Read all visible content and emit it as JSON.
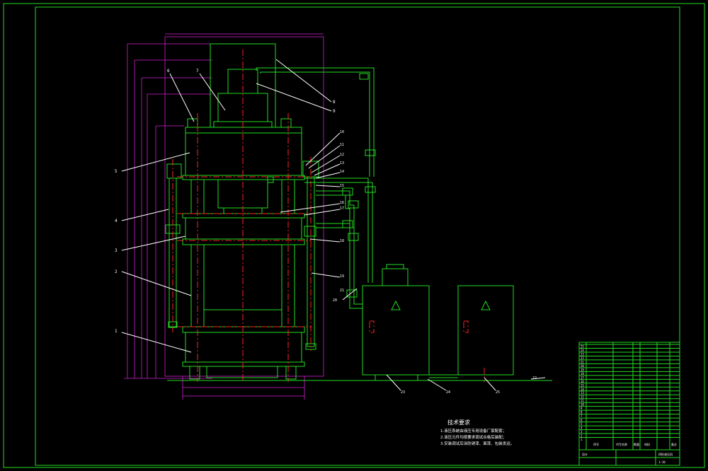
{
  "colors": {
    "background": "#000000",
    "outline": "#22dd22",
    "centerline": "#ff2222",
    "dimension": "#d020d0",
    "leader": "#ffffff"
  },
  "callouts": [
    "1",
    "2",
    "3",
    "4",
    "5",
    "6",
    "7",
    "8",
    "9",
    "10",
    "11",
    "12",
    "13",
    "14",
    "15",
    "16",
    "17",
    "18",
    "19",
    "20",
    "21",
    "22",
    "23",
    "24",
    "25"
  ],
  "technical_requirements": {
    "title": "技术要求",
    "lines": [
      "1.液压系统由液压专用设备厂家配套；",
      "2.液压元件均按要求调试合格后装配；",
      "3.安装调试后涂防锈漆、面漆、包装发运。"
    ]
  },
  "title_block": {
    "rows": [
      "1",
      "2",
      "3",
      "4",
      "5",
      "6",
      "7",
      "8",
      "9",
      "10",
      "11",
      "12",
      "13",
      "14",
      "15",
      "16",
      "17",
      "18",
      "19",
      "20",
      "21",
      "22",
      "23",
      "24",
      "25"
    ],
    "headers": [
      "序号",
      "代号",
      "名称",
      "数量",
      "材料",
      "备注"
    ],
    "footer": {
      "designer": "设计",
      "drawing_name": "四柱液压机",
      "scale": "1:10"
    }
  }
}
